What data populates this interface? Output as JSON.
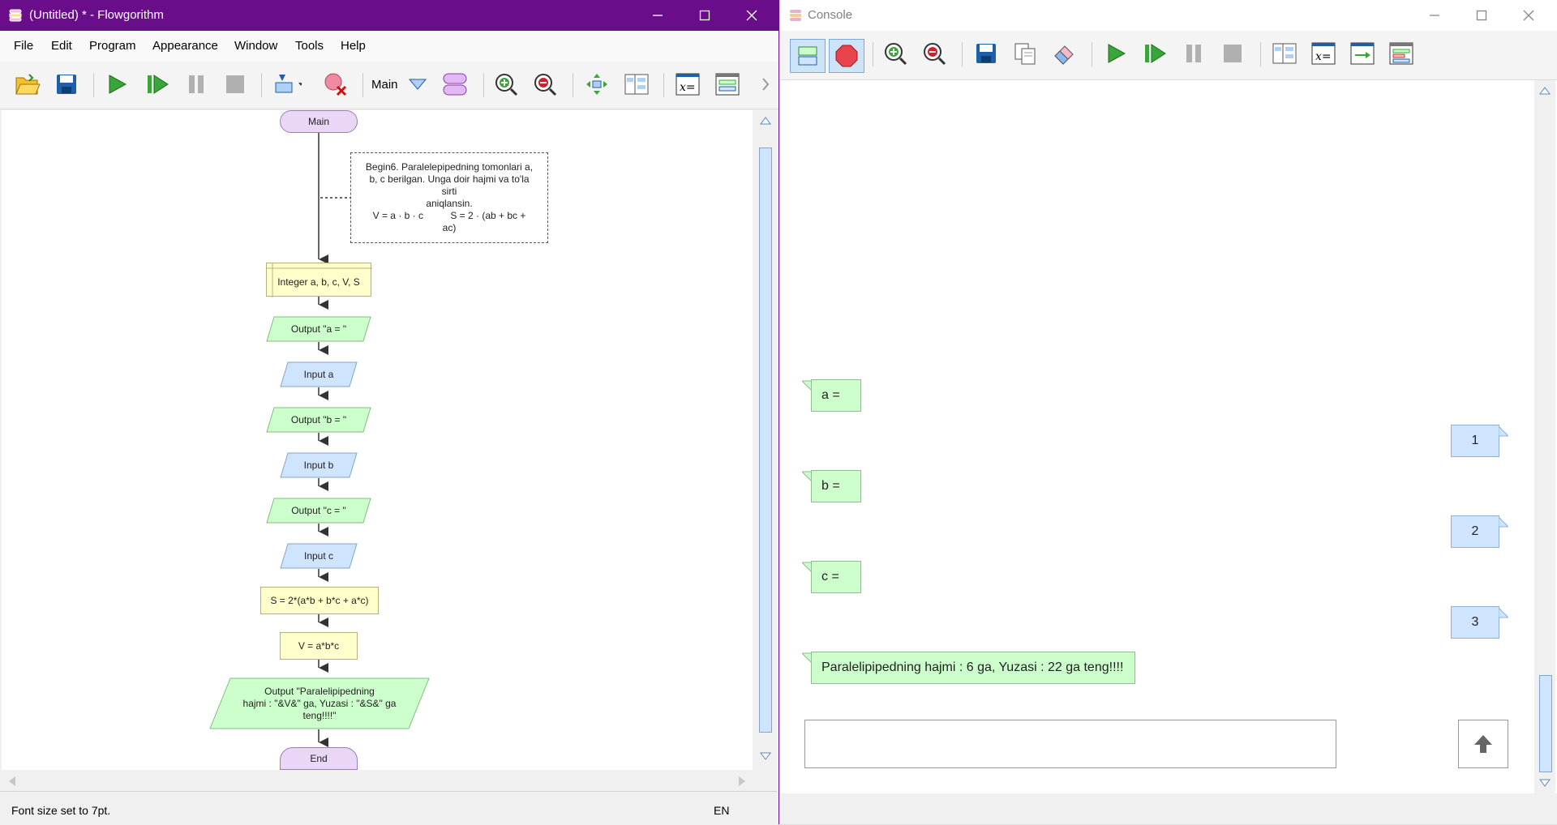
{
  "flowgorithm": {
    "title": "(Untitled) * - Flowgorithm",
    "menu": [
      "File",
      "Edit",
      "Program",
      "Appearance",
      "Window",
      "Tools",
      "Help"
    ],
    "toolbar": {
      "function_selector": "Main",
      "icons": [
        "open-icon",
        "save-icon",
        "run-icon",
        "step-icon",
        "pause-icon",
        "stop-icon",
        "add-shape-icon",
        "delete-shape-icon",
        "function-dropdown-icon",
        "manage-functions-icon",
        "zoom-in-icon",
        "zoom-out-icon",
        "layout-icon",
        "split-view-icon",
        "variable-watch-icon",
        "console-icon",
        "more-icon"
      ]
    },
    "flowchart": {
      "start": "Main",
      "comment": [
        "Begin6. Paralelepipedning tomonlari a,",
        "b, c berilgan. Unga doir hajmi va to'la",
        "sirti",
        "aniqlansin.",
        "V = a · b · c          S = 2 · (ab + bc +",
        "ac)"
      ],
      "declare": "Integer a, b, c, V, S",
      "output_a": "Output \"a = \"",
      "input_a": "Input a",
      "output_b": "Output \"b = \"",
      "input_b": "Input b",
      "output_c": "Output \"c = \"",
      "input_c": "Input c",
      "assign_s": "S = 2*(a*b + b*c + a*c)",
      "assign_v": "V = a*b*c",
      "output_result": [
        "Output \"Paralelipipedning",
        "hajmi : \"&V&\" ga, Yuzasi : \"&S&\" ga",
        "teng!!!!\""
      ],
      "end": "End"
    },
    "status": {
      "message": "Font size set to 7pt.",
      "language": "EN"
    }
  },
  "console": {
    "title": "Console",
    "toolbar_icons": [
      "chat-mode-icon",
      "stop-sign-icon",
      "zoom-in-icon",
      "zoom-out-icon",
      "save-icon",
      "copy-icon",
      "eraser-icon",
      "run-icon",
      "step-icon",
      "pause-icon",
      "stop-icon",
      "split-view-icon",
      "variable-watch-icon",
      "output-icon",
      "layout-icon"
    ],
    "messages": [
      {
        "kind": "output",
        "text": "a ="
      },
      {
        "kind": "input",
        "text": "1"
      },
      {
        "kind": "output",
        "text": "b ="
      },
      {
        "kind": "input",
        "text": "2"
      },
      {
        "kind": "output",
        "text": "c ="
      },
      {
        "kind": "input",
        "text": "3"
      },
      {
        "kind": "output",
        "text": "Paralelipipedning hajmi : 6 ga, Yuzasi : 22 ga teng!!!!"
      }
    ],
    "input_value": ""
  }
}
